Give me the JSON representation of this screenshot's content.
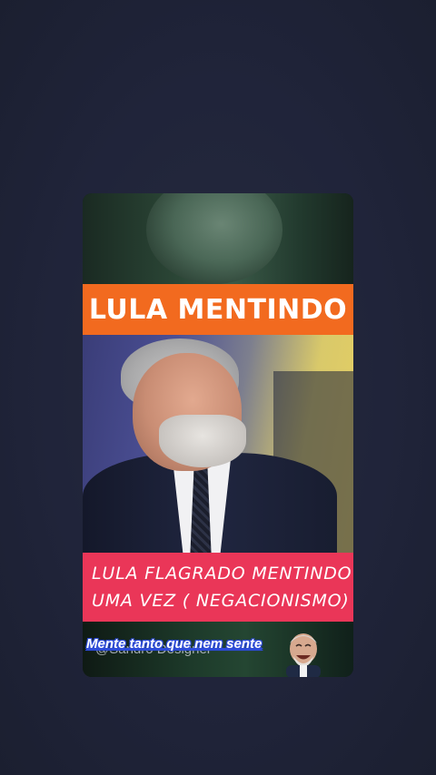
{
  "video": {
    "headline": "LULA MENTINDO",
    "caption_line1": "LULA FLAGRADO MENTINDO MAIS",
    "caption_line2": "UMA VEZ ( NEGACIONISMO)",
    "watermark": "@Sandro Designer",
    "overlay_text": "Mente tanto que nem sente",
    "sticker": "laughing-face-sticker"
  },
  "colors": {
    "background": "#22263a",
    "headline_banner": "#f26a1f",
    "caption_banner": "#ea3658",
    "overlay_outline": "#2d4bd8"
  }
}
